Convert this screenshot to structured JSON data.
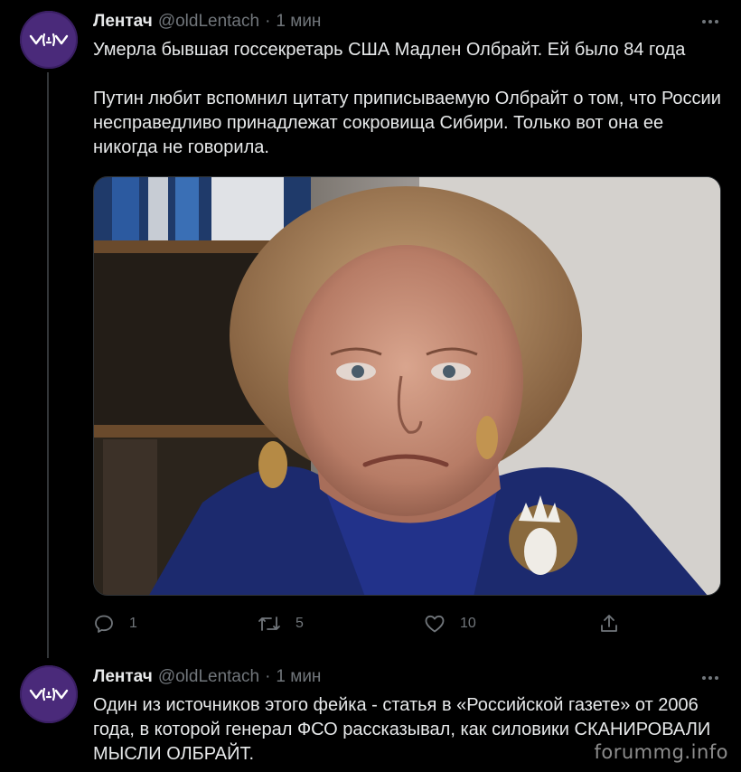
{
  "tweets": [
    {
      "author": {
        "name": "Лентач",
        "handle": "@oldLentach",
        "time": "1 мин"
      },
      "paragraphs": [
        "Умерла бывшая госсекретарь США Мадлен Олбрайт. Ей было 84 года",
        "Путин любит вспомнил цитату приписываемую Олбрайт о том, что России несправедливо принадлежат сокровища Сибири. Только вот она ее никогда не говорила."
      ],
      "media": {
        "description_icon": "photo"
      },
      "actions": {
        "reply": "1",
        "retweet": "5",
        "like": "10"
      }
    },
    {
      "author": {
        "name": "Лентач",
        "handle": "@oldLentach",
        "time": "1 мин"
      },
      "paragraphs": [
        "Один из источников этого фейка - статья в «Российской газете» от 2006 года, в которой генерал ФСО рассказывал, как силовики СКАНИРОВАЛИ МЫСЛИ ОЛБРАЙТ."
      ]
    }
  ],
  "separator": "·",
  "watermark": "forummg.info",
  "colors": {
    "background": "#000000",
    "text": "#e7e9ea",
    "muted": "#71767b",
    "avatar": "#4a2a7a"
  }
}
